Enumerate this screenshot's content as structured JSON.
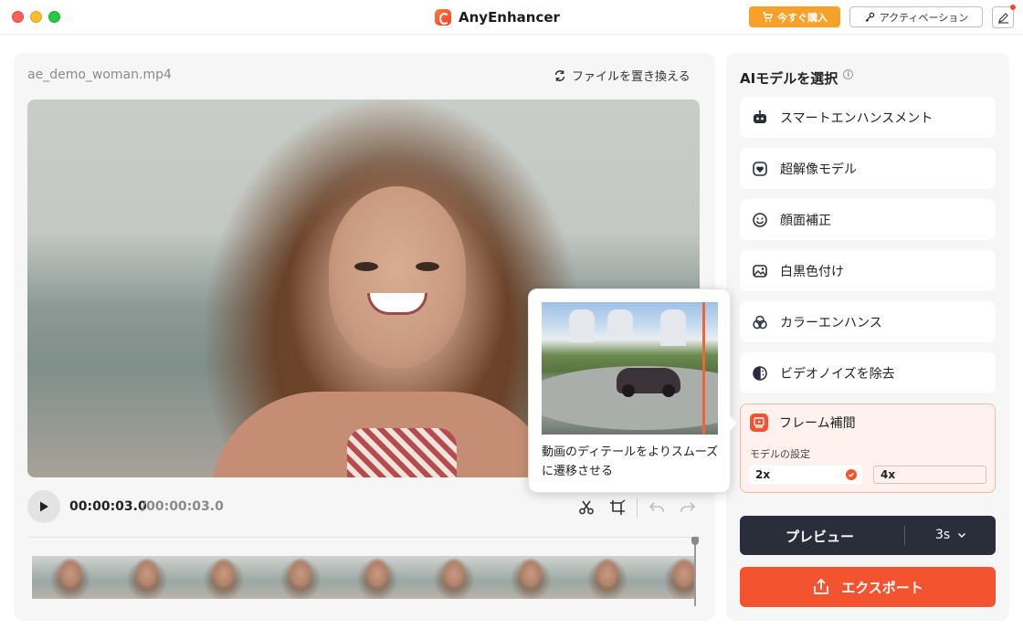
{
  "window": {
    "title": "AnyEnhancer"
  },
  "header": {
    "buy_label": "今すぐ購入",
    "activate_label": "アクティベーション"
  },
  "editor": {
    "file_name": "ae_demo_woman.mp4",
    "replace_label": "ファイルを置き換える",
    "time_current": "00:00:03.0",
    "time_total": "/00:00:03.0"
  },
  "models": {
    "title": "AIモデルを選択",
    "items": [
      {
        "label": "スマートエンハンスメント",
        "icon": "robot-icon"
      },
      {
        "label": "超解像モデル",
        "icon": "heart-shield-icon"
      },
      {
        "label": "顔面補正",
        "icon": "smile-icon"
      },
      {
        "label": "白黒色付け",
        "icon": "colorize-photo-icon"
      },
      {
        "label": "カラーエンハンス",
        "icon": "color-circles-icon"
      },
      {
        "label": "ビデオノイズを除去",
        "icon": "denoise-icon"
      }
    ],
    "active": {
      "label": "フレーム補間",
      "icon": "frame-interpolation-icon",
      "settings_label": "モデルの設定",
      "options": [
        "2x",
        "4x"
      ],
      "selected": "2x"
    }
  },
  "actions": {
    "preview_label": "プレビュー",
    "preview_duration": "3s",
    "export_label": "エクスポート"
  },
  "tooltip": {
    "text": "動画のディテールをよりスムーズに遷移させる"
  },
  "colors": {
    "accent": "#f4532f",
    "buy": "#f7a12a",
    "preview_bg": "#2a2d3a",
    "active_bg": "#fff2ee"
  }
}
